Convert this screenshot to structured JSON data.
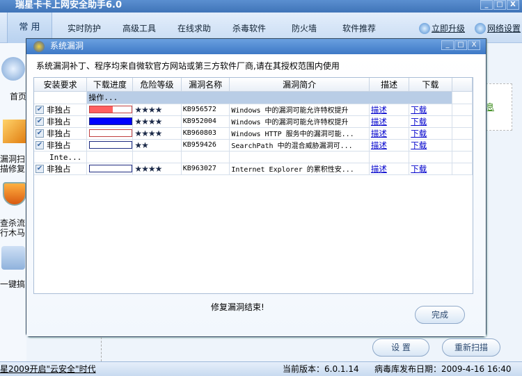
{
  "app": {
    "title": "瑞星卡卡上网安全助手6.0",
    "win_buttons": [
      "_",
      "□",
      "X"
    ]
  },
  "nav": {
    "tabs": [
      "常 用",
      "实时防护",
      "高级工具",
      "在线求助",
      "杀毒软件",
      "防火墙",
      "软件推荐"
    ],
    "upgrade": "立即升级",
    "network": "网络设置"
  },
  "sidebar": {
    "items": [
      "首页",
      "漏洞扫描修复",
      "查杀流行木马",
      "一键搞"
    ]
  },
  "right_panel": {
    "partial_link": "息"
  },
  "dialog": {
    "title": "系统漏洞",
    "notice": "系统漏洞补丁、程序均来自微软官方网站或第三方软件厂商,请在其授权范围内使用",
    "columns": [
      "安装要求",
      "下载进度",
      "危险等级",
      "漏洞名称",
      "漏洞简介",
      "描述",
      "下载"
    ],
    "groups": [
      {
        "label": "操作...",
        "rows": [
          {
            "checked": true,
            "req": "非独占",
            "progress": 0.55,
            "bar_color": "#ff6060",
            "border": "#c04040",
            "stars": "★★★★",
            "kb": "KB956572",
            "desc": "Windows 中的漏洞可能允许特权提升",
            "desc_link": "描述",
            "dl_link": "下载"
          },
          {
            "checked": true,
            "req": "非独占",
            "progress": 1.0,
            "bar_color": "#0000ff",
            "border": "#1d2a80",
            "stars": "★★★★",
            "kb": "KB952004",
            "desc": "Windows 中的漏洞可能允许特权提升",
            "desc_link": "描述",
            "dl_link": "下载"
          },
          {
            "checked": true,
            "req": "非独占",
            "progress": 0,
            "bar_color": "#ff6060",
            "border": "#c04040",
            "stars": "★★★★",
            "kb": "KB960803",
            "desc": "Windows HTTP 服务中的漏洞可能...",
            "desc_link": "描述",
            "dl_link": "下载"
          },
          {
            "checked": true,
            "req": "非独占",
            "progress": 0,
            "bar_color": "#0000ff",
            "border": "#1d2a80",
            "stars": "★★",
            "kb": "KB959426",
            "desc": "SearchPath 中的混合威胁漏洞可...",
            "desc_link": "描述",
            "dl_link": "下载"
          }
        ]
      },
      {
        "label": "Inte...",
        "rows": [
          {
            "checked": true,
            "req": "非独占",
            "progress": 0,
            "bar_color": "#0000ff",
            "border": "#1d2a80",
            "stars": "★★★★",
            "kb": "KB963027",
            "desc": "Internet Explorer 的累积性安...",
            "desc_link": "描述",
            "dl_link": "下载"
          }
        ]
      }
    ],
    "status": "修复漏洞结束!",
    "finish": "完成"
  },
  "buttons": {
    "settings": "设 置",
    "rescan": "重新扫描"
  },
  "statusbar": {
    "slogan": "星2009开启\"云安全\"时代",
    "version": "当前版本：6.0.1.14",
    "virus_db": "病毒库发布日期：2009-4-16 16:40"
  }
}
